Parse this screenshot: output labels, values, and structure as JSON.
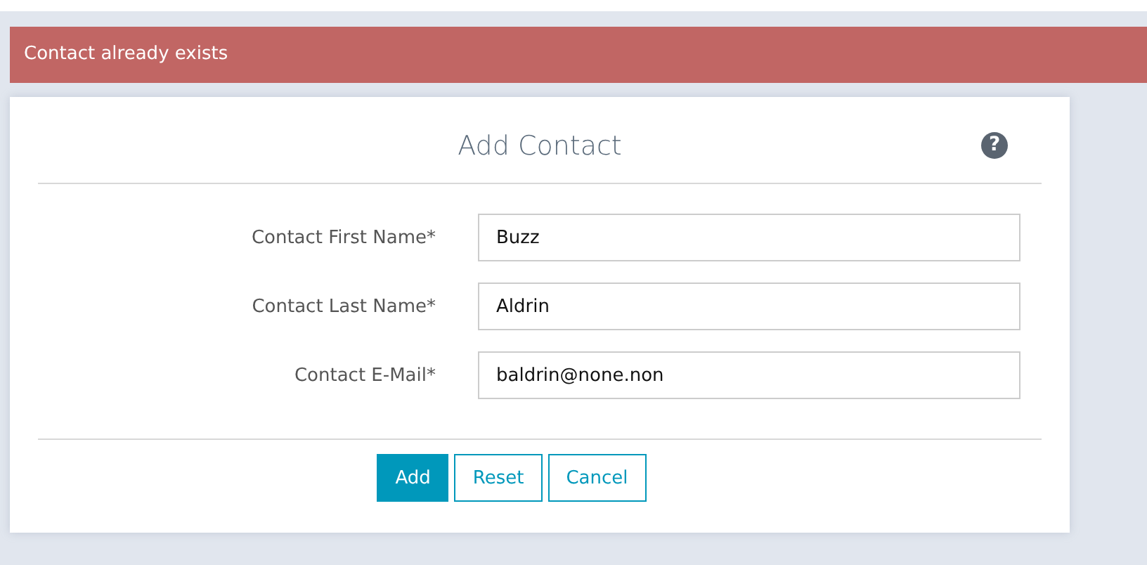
{
  "alert": {
    "kind": "error",
    "text": "Contact already exists"
  },
  "form": {
    "title": "Add Contact",
    "help": "?",
    "fields": [
      {
        "label": "Contact First Name*",
        "value": "Buzz"
      },
      {
        "label": "Contact Last Name*",
        "value": "Aldrin"
      },
      {
        "label": "Contact E-Mail*",
        "value": "baldrin@none.non"
      }
    ],
    "buttons": [
      {
        "label": "Add",
        "kind": "primary"
      },
      {
        "label": "Reset",
        "kind": "outline"
      },
      {
        "label": "Cancel",
        "kind": "outline"
      }
    ]
  }
}
